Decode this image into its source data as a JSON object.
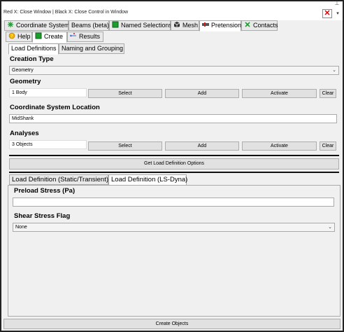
{
  "window": {
    "title": "Red X: Close Window | Black X: Close Control in Window",
    "pin_glyph": "⊥",
    "close_glyph": "✕",
    "menu_glyph": "▾"
  },
  "main_tabs": [
    {
      "label": "Coordinate Systems",
      "icon": "coordinate-axes-icon"
    },
    {
      "label": "Beams (beta)",
      "icon": ""
    },
    {
      "label": "Named Selections",
      "icon": "named-selection-icon"
    },
    {
      "label": "Mesh",
      "icon": "mesh-icon"
    },
    {
      "label": "Pretension",
      "icon": "pretension-icon"
    },
    {
      "label": "Contacts",
      "icon": "contacts-icon"
    }
  ],
  "sub_tabs": [
    {
      "label": "Help",
      "icon": "help-icon"
    },
    {
      "label": "Create",
      "icon": "create-icon"
    },
    {
      "label": "Results",
      "icon": "results-icon"
    }
  ],
  "section_tabs": [
    {
      "label": "Load Definitions"
    },
    {
      "label": "Naming and Grouping"
    }
  ],
  "creation_type": {
    "label": "Creation Type",
    "value": "Geometry",
    "arrow": "⌄"
  },
  "geometry": {
    "label": "Geometry",
    "value": "1 Body",
    "select": "Select",
    "add": "Add",
    "activate": "Activate",
    "clear": "Clear"
  },
  "csys_location": {
    "label": "Coordinate System Location",
    "value": "MidShank"
  },
  "analyses": {
    "label": "Analyses",
    "value": "3 Objects",
    "select": "Select",
    "add": "Add",
    "activate": "Activate",
    "clear": "Clear"
  },
  "get_load_button": "Get Load Definition Options",
  "load_tabs": [
    {
      "label": "Load Definition (Static/Transient)"
    },
    {
      "label": "Load Definition (LS-Dyna)"
    }
  ],
  "preload_stress": {
    "label": "Preload Stress (Pa)",
    "value": ""
  },
  "shear_stress_flag": {
    "label": "Shear Stress Flag",
    "value": "None",
    "arrow": "⌄"
  },
  "create_objects_button": "Create Objects",
  "colors": {
    "accent_green": "#1a9e2c",
    "close_red": "#dd0000",
    "active_tab": "#ffffff"
  }
}
